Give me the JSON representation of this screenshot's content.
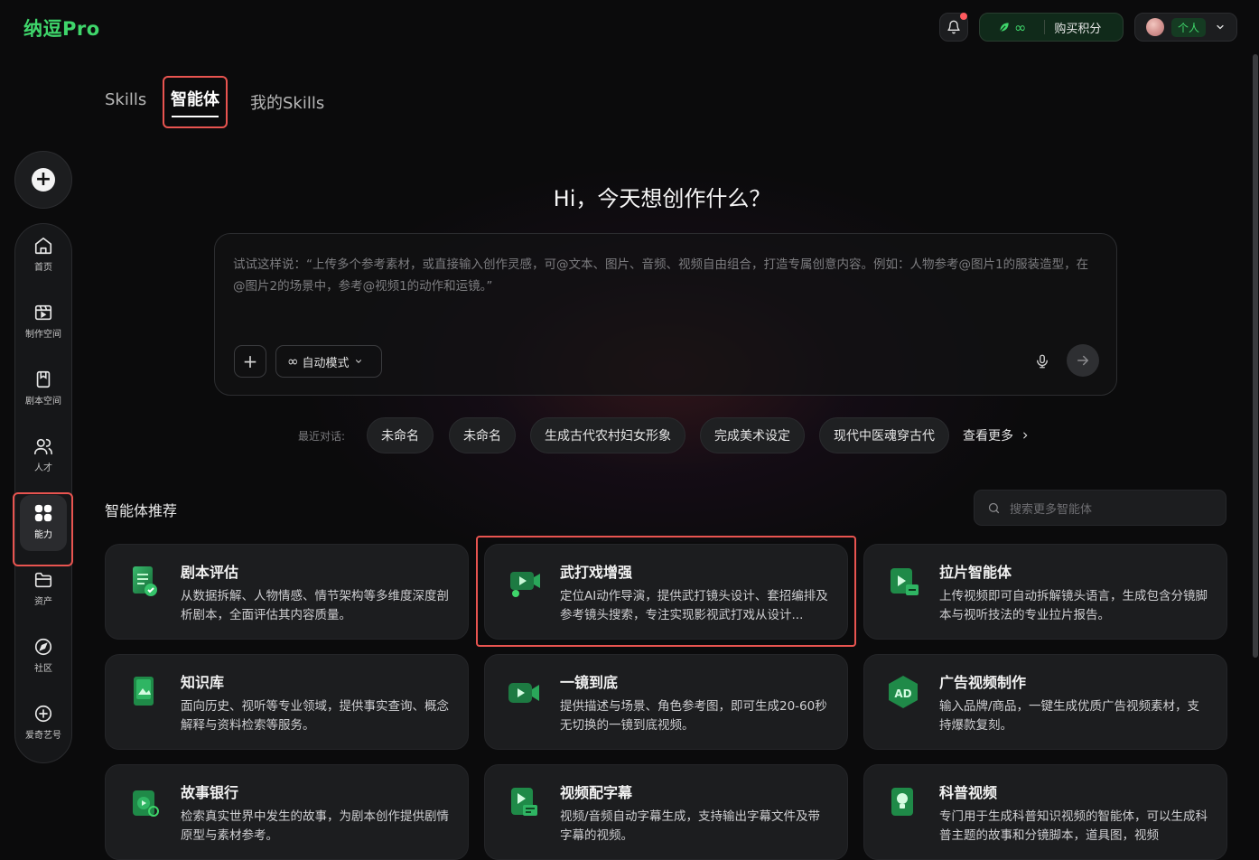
{
  "brand": {
    "logo_text": "纳逗Pro",
    "accent": "#3fd66b",
    "highlight": "#e85450"
  },
  "header": {
    "notification_icon": "bell-icon",
    "credits_value": "∞",
    "buy_credits_label": "购买积分",
    "plan_label": "个人"
  },
  "tabs": [
    {
      "label": "Skills",
      "active": false
    },
    {
      "label": "智能体",
      "active": true
    },
    {
      "label": "我的Skills",
      "active": false
    }
  ],
  "sidebar": {
    "new_icon": "plus-icon",
    "items": [
      {
        "label": "首页",
        "icon": "home-icon"
      },
      {
        "label": "制作空间",
        "icon": "workspace-icon"
      },
      {
        "label": "剧本空间",
        "icon": "script-icon"
      },
      {
        "label": "人才",
        "icon": "people-icon"
      },
      {
        "label": "能力",
        "icon": "grid-icon",
        "active": true
      },
      {
        "label": "资产",
        "icon": "folder-icon"
      },
      {
        "label": "社区",
        "icon": "compass-icon"
      },
      {
        "label": "爱奇艺号",
        "icon": "add-circle-icon"
      }
    ]
  },
  "hero": {
    "title": "Hi，今天想创作什么？",
    "placeholder": "试试这样说：“上传多个参考素材，或直接输入创作灵感，可@文本、图片、音频、视频自由组合，打造专属创意内容。例如：人物参考@图片1的服装造型，在@图片2的场景中，参考@视频1的动作和运镜。”",
    "mode_label": "自动模式",
    "mode_icon": "infinity-icon"
  },
  "recent": {
    "label": "最近对话:",
    "chips": [
      "未命名",
      "未命名",
      "生成古代农村妇女形象",
      "完成美术设定",
      "现代中医魂穿古代"
    ],
    "see_more": "查看更多"
  },
  "agents": {
    "section_title": "智能体推荐",
    "search_placeholder": "搜索更多智能体",
    "cards": [
      {
        "title": "剧本评估",
        "desc": "从数据拆解、人物情感、情节架构等多维度深度剖析剧本，全面评估其内容质量。",
        "icon": "document-check-icon"
      },
      {
        "title": "武打戏增强",
        "desc": "定位AI动作导演，提供武打镜头设计、套招编排及参考镜头搜索，专注实现影视武打戏从设计...",
        "icon": "action-video-icon"
      },
      {
        "title": "拉片智能体",
        "desc": "上传视频即可自动拆解镜头语言，生成包含分镜脚本与视听技法的专业拉片报告。",
        "icon": "film-analysis-icon"
      },
      {
        "title": "知识库",
        "desc": "面向历史、视听等专业领域，提供事实查询、概念解释与资料检索等服务。",
        "icon": "book-icon"
      },
      {
        "title": "一镜到底",
        "desc": "提供描述与场景、角色参考图，即可生成20-60秒无切换的一镜到底视频。",
        "icon": "camera-icon"
      },
      {
        "title": "广告视频制作",
        "desc": "输入品牌/商品，一键生成优质广告视频素材，支持爆款复刻。",
        "icon": "ad-icon"
      },
      {
        "title": "故事银行",
        "desc": "检索真实世界中发生的故事，为剧本创作提供剧情原型与素材参考。",
        "icon": "story-bank-icon"
      },
      {
        "title": "视频配字幕",
        "desc": "视频/音频自动字幕生成，支持输出字幕文件及带字幕的视频。",
        "icon": "subtitle-icon"
      },
      {
        "title": "科普视频",
        "desc": "专门用于生成科普知识视频的智能体，可以生成科普主题的故事和分镜脚本，道具图，视频",
        "icon": "lightbulb-icon"
      }
    ]
  }
}
